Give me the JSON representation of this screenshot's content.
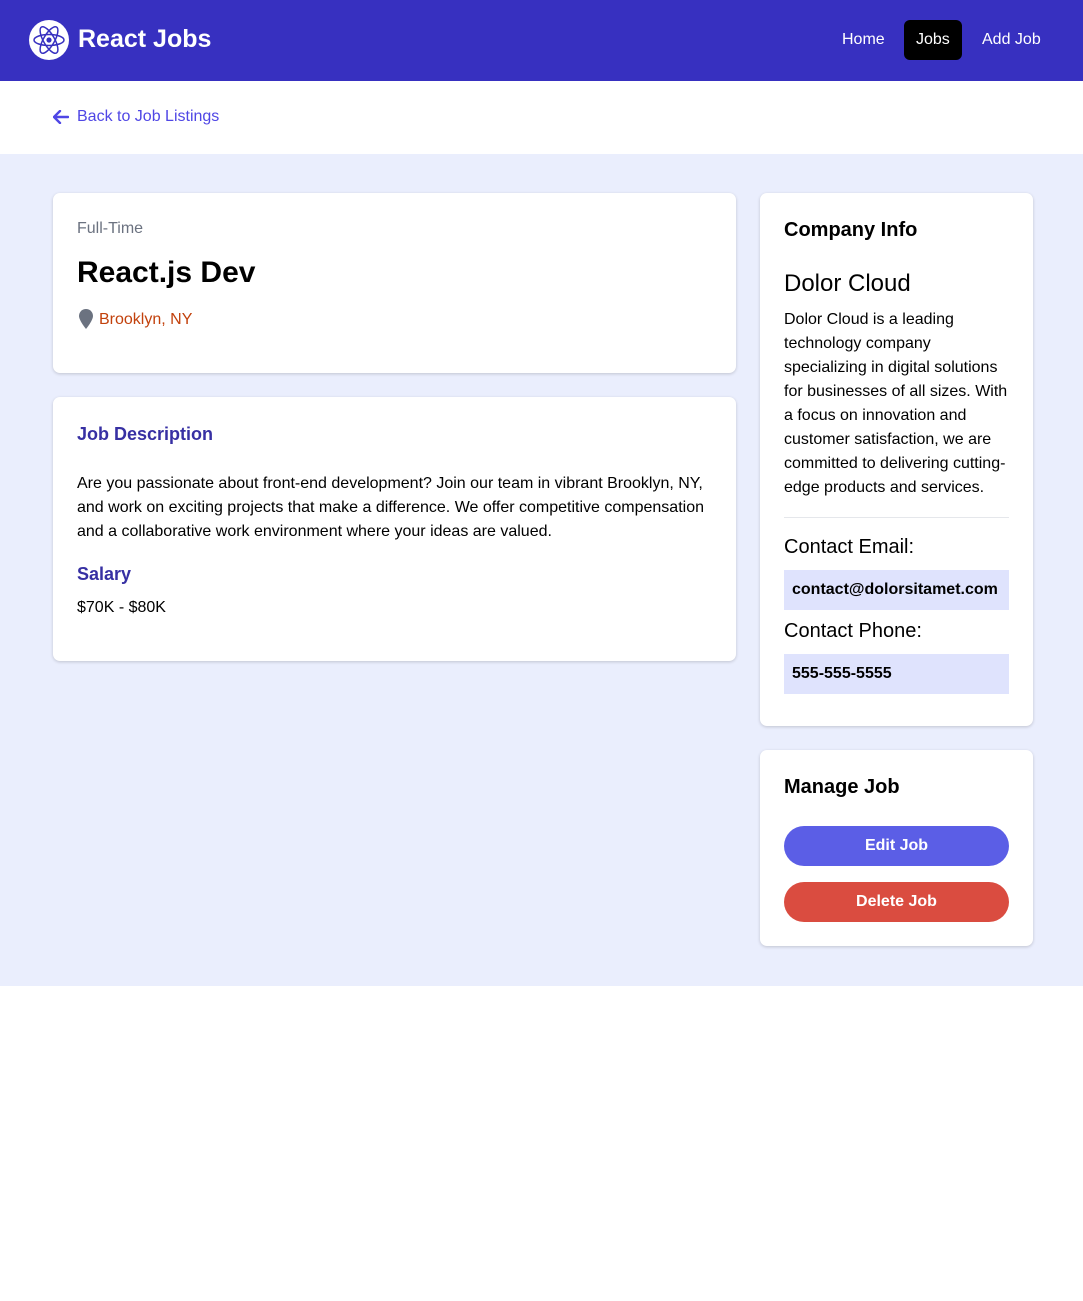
{
  "brand": {
    "name": "React Jobs",
    "icon": "react-atom-icon"
  },
  "nav": {
    "home": "Home",
    "jobs": "Jobs",
    "add_job": "Add Job"
  },
  "back": {
    "label": "Back to Job Listings",
    "icon": "arrow-left-icon"
  },
  "job": {
    "type": "Full-Time",
    "title": "React.js Dev",
    "location": "Brooklyn, NY",
    "description_heading": "Job Description",
    "description": "Are you passionate about front-end development? Join our team in vibrant Brooklyn, NY, and work on exciting projects that make a difference. We offer competitive compensation and a collaborative work environment where your ideas are valued.",
    "salary_heading": "Salary",
    "salary": "$70K - $80K"
  },
  "company": {
    "heading": "Company Info",
    "name": "Dolor Cloud",
    "description": "Dolor Cloud is a leading technology company specializing in digital solutions for businesses of all sizes. With a focus on innovation and customer satisfaction, we are committed to delivering cutting-edge products and services.",
    "email_label": "Contact Email:",
    "email": "contact@dolorsitamet.com",
    "phone_label": "Contact Phone:",
    "phone": "555-555-5555"
  },
  "manage": {
    "heading": "Manage Job",
    "edit": "Edit Job",
    "delete": "Delete Job"
  },
  "colors": {
    "navbar": "#3730c0",
    "accent": "#4f46e5",
    "danger": "#da4c40",
    "page_bg": "#eaeefd"
  }
}
